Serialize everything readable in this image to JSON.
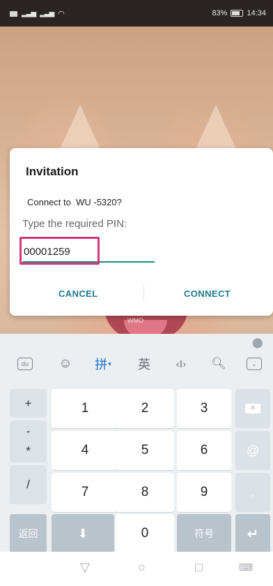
{
  "status_bar": {
    "battery": "83%",
    "time": "14:34"
  },
  "background": {
    "watermark": "WMO"
  },
  "dialog": {
    "title": "Invitation",
    "message": "Connect to  WU -5320?",
    "pin_label": "Type the required PIN:",
    "pin_value": "00001259",
    "cancel_label": "CANCEL",
    "connect_label": "CONNECT",
    "accent_color": "#1c7a8c",
    "highlight_color": "#d4347a"
  },
  "keyboard": {
    "toolbar": {
      "pinyin_label": "拼",
      "english_label": "英",
      "cursor_label": "‹I›"
    },
    "side_keys": [
      "+",
      "-",
      "*",
      "/"
    ],
    "rows": [
      [
        "1",
        "2",
        "3"
      ],
      [
        "4",
        "5",
        "6"
      ],
      [
        "7",
        "8",
        "9"
      ]
    ],
    "at_label": "@",
    "dot_label": ".",
    "back_label": "返回",
    "zero_label": "0",
    "symbols_label": "符号",
    "enter_icon": "enter-icon",
    "backspace_icon": "backspace-icon"
  },
  "nav": {
    "back_icon": "triangle-back-icon",
    "home_icon": "circle-home-icon",
    "recents_icon": "square-recents-icon",
    "keyboard_icon": "keyboard-icon"
  }
}
